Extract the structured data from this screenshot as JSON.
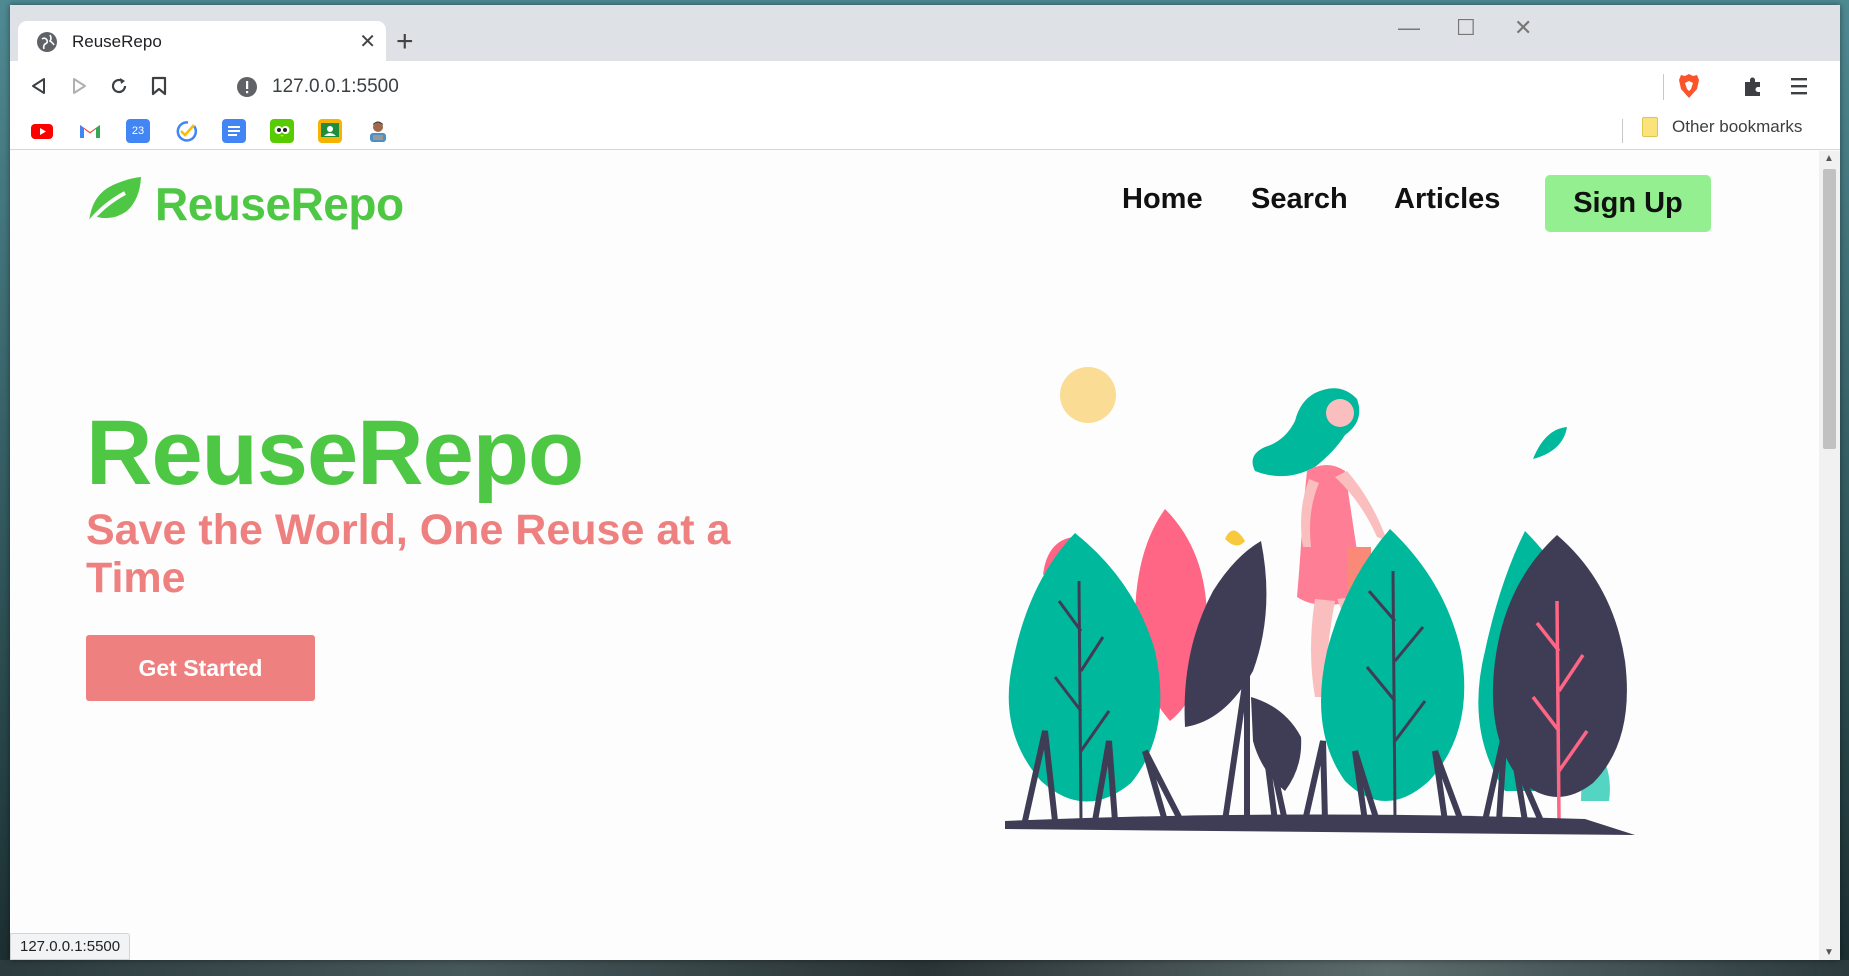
{
  "browser": {
    "tab_title": "ReuseRepo",
    "url": "127.0.0.1:5500",
    "status_url": "127.0.0.1:5500",
    "bookmarks": [
      "youtube-icon",
      "gmail-icon",
      "calendar-icon",
      "tasks-icon",
      "docs-icon",
      "duolingo-icon",
      "classroom-icon",
      "avatar-icon"
    ],
    "calendar_day": "23",
    "other_bookmarks_label": "Other bookmarks"
  },
  "site": {
    "logo_text": "ReuseRepo",
    "nav": {
      "home": "Home",
      "search": "Search",
      "articles": "Articles",
      "signup": "Sign Up"
    },
    "hero": {
      "title": "ReuseRepo",
      "subtitle": "Save the World, One Reuse at a Time",
      "cta": "Get Started"
    }
  },
  "colors": {
    "brand_green": "#4ec844",
    "accent_pink": "#ef8080",
    "signup_green": "#93ef8f",
    "plant_teal": "#00b89c",
    "plant_dark": "#3f3d56",
    "plant_pink": "#ff6584"
  }
}
